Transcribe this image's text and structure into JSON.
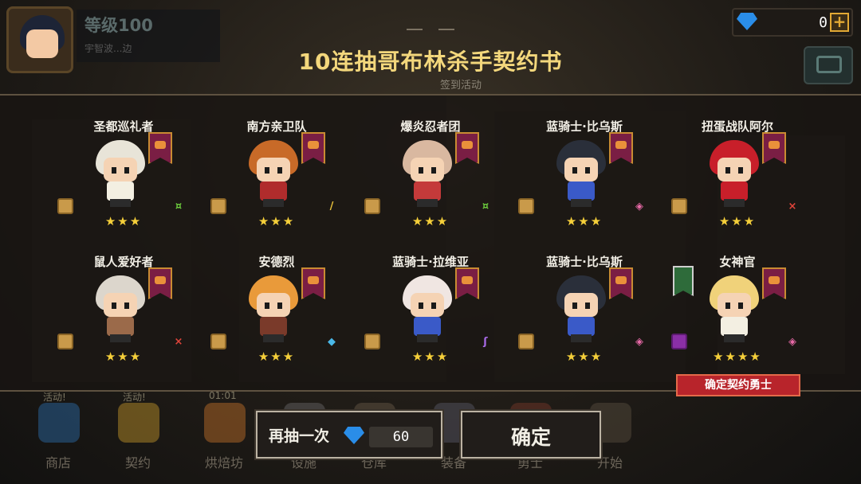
{
  "player": {
    "level": "等级100",
    "subtitle": "宇智波...边"
  },
  "currency": {
    "gems": "0",
    "plus": "+"
  },
  "dialog": {
    "title": "10连抽哥布林杀手契约书",
    "activity_label": "签到活动"
  },
  "colors": {
    "title": "#f3d77c",
    "stars": "#f5cf3a",
    "banner": "#7a1e44",
    "confirm_tag": "#b8242b",
    "gem": "#2a8de8"
  },
  "heroes": [
    {
      "name": "圣都巡礼者",
      "stars": "★★★",
      "weapon_icon": "staff-icon",
      "weapon_glyph": "¤",
      "weapon_color": "#6ecf3e",
      "hair": "#e8e4d8",
      "outfit": "#f3efe2"
    },
    {
      "name": "南方亲卫队",
      "stars": "★★★",
      "weapon_icon": "sword-icon",
      "weapon_glyph": "/",
      "weapon_color": "#e9c23b",
      "hair": "#c86a28",
      "outfit": "#b02c2c"
    },
    {
      "name": "爆炎忍者团",
      "stars": "★★★",
      "weapon_icon": "staff-icon",
      "weapon_glyph": "¤",
      "weapon_color": "#6ecf3e",
      "hair": "#d9b8a0",
      "outfit": "#c43a3a"
    },
    {
      "name": "蓝骑士·比乌斯",
      "stars": "★★★",
      "weapon_icon": "orb-icon",
      "weapon_glyph": "◈",
      "weapon_color": "#e96aa8",
      "hair": "#2a2f3a",
      "outfit": "#3a5ac8"
    },
    {
      "name": "扭蛋战队阿尔",
      "stars": "★★★",
      "weapon_icon": "claw-icon",
      "weapon_glyph": "×",
      "weapon_color": "#e0443a",
      "hair": "#c81f2a",
      "outfit": "#c81f2a"
    },
    {
      "name": "鼠人爱好者",
      "stars": "★★★",
      "weapon_icon": "claw-icon",
      "weapon_glyph": "×",
      "weapon_color": "#e0443a",
      "hair": "#dcd6cc",
      "outfit": "#9b6a4a"
    },
    {
      "name": "安德烈",
      "stars": "★★★",
      "weapon_icon": "axe-icon",
      "weapon_glyph": "◆",
      "weapon_color": "#4ab8e8",
      "hair": "#e99a3a",
      "outfit": "#7a3a2a"
    },
    {
      "name": "蓝骑士·拉维亚",
      "stars": "★★★",
      "weapon_icon": "whip-icon",
      "weapon_glyph": "ʃ",
      "weapon_color": "#a86ae8",
      "hair": "#f0e6e2",
      "outfit": "#3a5ac8"
    },
    {
      "name": "蓝骑士·比乌斯",
      "stars": "★★★",
      "weapon_icon": "orb-icon",
      "weapon_glyph": "◈",
      "weapon_color": "#e96aa8",
      "hair": "#2a2f3a",
      "outfit": "#3a5ac8"
    },
    {
      "name": "女神官",
      "stars": "★★★★",
      "weapon_icon": "orb-icon",
      "weapon_glyph": "◈",
      "weapon_color": "#e96aa8",
      "hair": "#f0d27a",
      "outfit": "#f3efe2"
    }
  ],
  "confirm_tag": "确定契约勇士",
  "actions": {
    "redraw_label": "再抽一次",
    "redraw_cost": "60",
    "confirm_label": "确定"
  },
  "nav": [
    {
      "label": "商店",
      "tag": "活动!",
      "color": "#2d6fb0"
    },
    {
      "label": "契约",
      "tag": "活动!",
      "color": "#c89a2a"
    },
    {
      "label": "烘焙坊",
      "tag": "01:01",
      "color": "#c8742a"
    },
    {
      "label": "设施",
      "tag": "",
      "color": "#6a6a6a"
    },
    {
      "label": "仓库",
      "tag": "",
      "color": "#6a5a4a"
    },
    {
      "label": "装备",
      "tag": "",
      "color": "#5a5a6a"
    },
    {
      "label": "勇士",
      "tag": "",
      "color": "#7a3a2a"
    },
    {
      "label": "开始",
      "tag": "",
      "color": "#5a5040"
    }
  ]
}
